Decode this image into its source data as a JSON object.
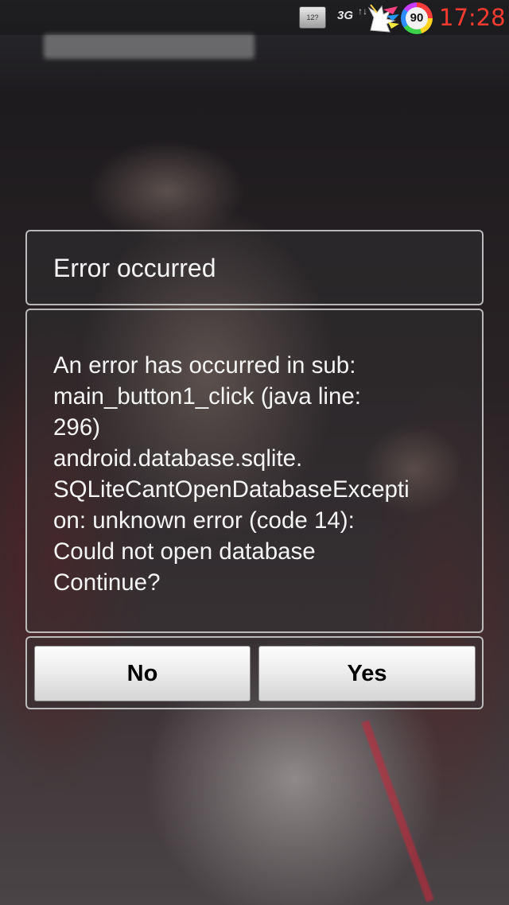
{
  "status_bar": {
    "calendar_icon": "calendar-icon",
    "calendar_text": "12?",
    "network_label": "3G",
    "data_arrows": "↑↓",
    "app_icon": "unicorn-icon",
    "battery_level": "90",
    "time": "17:28",
    "time_color": "#ff3b30"
  },
  "dialog": {
    "title": "Error occurred",
    "message": "An error has occurred in sub:\nmain_button1_click (java line:\n296)\nandroid.database.sqlite.\nSQLiteCantOpenDatabaseExcepti\non: unknown error (code 14):\nCould not open database\nContinue?",
    "buttons": {
      "no_label": "No",
      "yes_label": "Yes"
    },
    "border_color": "#d2d2d2",
    "text_color": "#f4f4f4"
  }
}
